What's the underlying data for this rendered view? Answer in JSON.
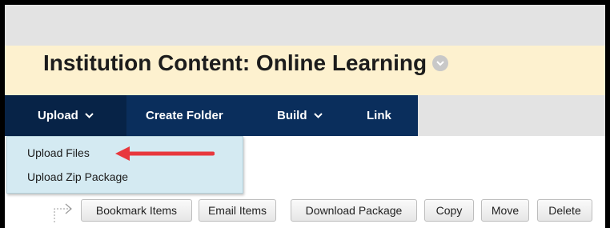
{
  "page": {
    "title": "Institution Content: Online Learning"
  },
  "nav": {
    "items": [
      {
        "label": "Upload",
        "has_menu": true
      },
      {
        "label": "Create Folder",
        "has_menu": false
      },
      {
        "label": "Build",
        "has_menu": true
      },
      {
        "label": "Link",
        "has_menu": false
      }
    ]
  },
  "dropdown": {
    "items": [
      {
        "label": "Upload Files"
      },
      {
        "label": "Upload Zip Package"
      }
    ]
  },
  "toolbar": {
    "buttons": [
      {
        "label": "Bookmark Items"
      },
      {
        "label": "Email Items"
      },
      {
        "label": "Download Package"
      },
      {
        "label": "Copy"
      },
      {
        "label": "Move"
      },
      {
        "label": "Delete"
      }
    ]
  },
  "colors": {
    "nav_bg": "#0a2e5c",
    "title_bg": "#fdf1cf",
    "dropdown_bg": "#d4eaf2",
    "annotation_arrow": "#e8383d"
  },
  "icons": {
    "title_menu": "chevron-down-circle-icon",
    "nav_menu": "chevron-down-icon",
    "annotation": "red-arrow-icon",
    "tree": "tree-branch-arrow-icon"
  }
}
